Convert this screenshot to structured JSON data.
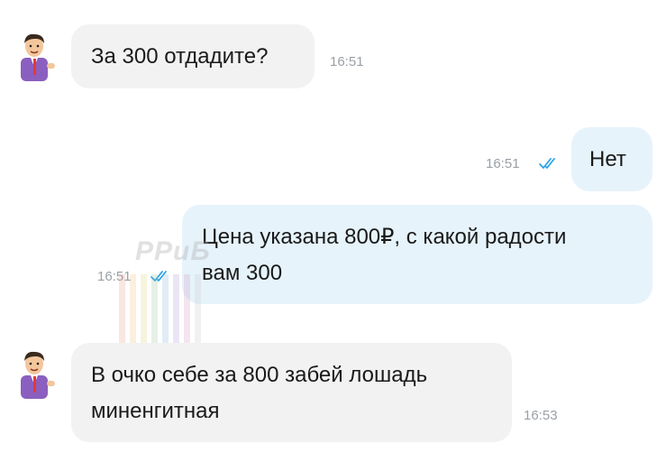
{
  "messages": [
    {
      "direction": "in",
      "text": "За 300 отдадите?",
      "time": "16:51"
    },
    {
      "direction": "out",
      "text": "Нет",
      "time": "16:51",
      "status": "read"
    },
    {
      "direction": "out",
      "lines": [
        "Цена указана 800₽, с какой радости",
        "вам 300"
      ],
      "time": "16:51",
      "status": "read"
    },
    {
      "direction": "in",
      "lines": [
        "В очко себе за 800 забей лошадь",
        "миненгитная"
      ],
      "time": "16:53"
    }
  ],
  "watermark": {
    "text": "РРиБ"
  },
  "icons": {
    "avatar": "cartoon-man-avatar-icon",
    "read_status": "double-check-icon"
  },
  "colors": {
    "incoming_bubble": "#f2f2f2",
    "outgoing_bubble": "#e6f3fb",
    "check": "#2ba3e8",
    "time": "#9aa0a6"
  }
}
